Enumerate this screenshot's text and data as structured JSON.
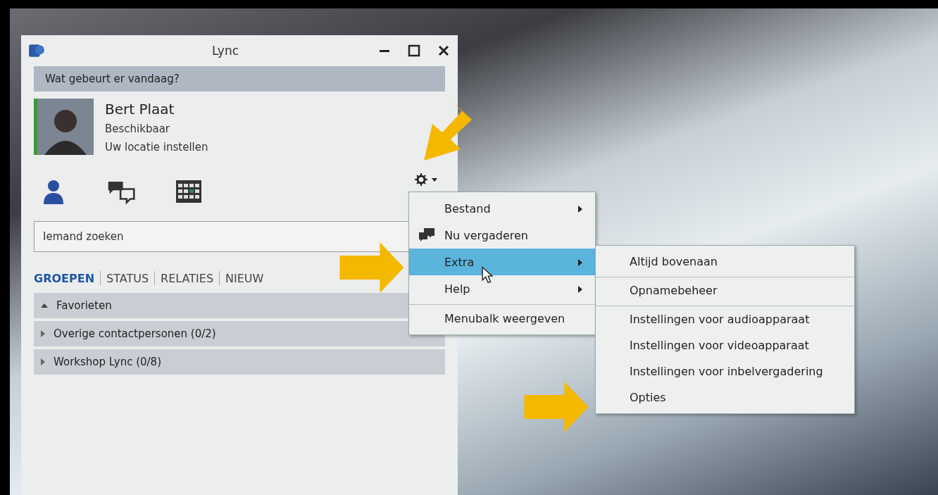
{
  "window": {
    "title": "Lync"
  },
  "status_note": {
    "placeholder": "Wat gebeurt er vandaag?"
  },
  "profile": {
    "name": "Bert Plaat",
    "presence": "Beschikbaar",
    "location": "Uw locatie instellen"
  },
  "search": {
    "placeholder": "Iemand zoeken"
  },
  "tabs": [
    {
      "label": "GROEPEN",
      "selected": true
    },
    {
      "label": "STATUS",
      "selected": false
    },
    {
      "label": "RELATIES",
      "selected": false
    },
    {
      "label": "NIEUW",
      "selected": false
    }
  ],
  "groups": [
    {
      "label": "Favorieten",
      "expanded": true
    },
    {
      "label": "Overige contactpersonen (0/2)",
      "expanded": false
    },
    {
      "label": "Workshop Lync (0/8)",
      "expanded": false
    }
  ],
  "menu": {
    "items": [
      {
        "label": "Bestand",
        "submenu": true,
        "selected": false,
        "separator_before": false
      },
      {
        "label": "Nu vergaderen",
        "submenu": false,
        "selected": false,
        "separator_before": false
      },
      {
        "label": "Extra",
        "submenu": true,
        "selected": true,
        "separator_before": false
      },
      {
        "label": "Help",
        "submenu": true,
        "selected": false,
        "separator_before": false
      },
      {
        "label": "Menubalk weergeven",
        "submenu": false,
        "selected": false,
        "separator_before": true
      }
    ]
  },
  "submenu": {
    "items": [
      {
        "label": "Altijd bovenaan",
        "separator_before": false
      },
      {
        "label": "Opnamebeheer",
        "separator_before": true
      },
      {
        "label": "Instellingen voor audioapparaat",
        "separator_before": true
      },
      {
        "label": "Instellingen voor videoapparaat",
        "separator_before": false
      },
      {
        "label": "Instellingen voor inbelvergadering",
        "separator_before": false
      },
      {
        "label": "Opties",
        "separator_before": false
      }
    ]
  }
}
